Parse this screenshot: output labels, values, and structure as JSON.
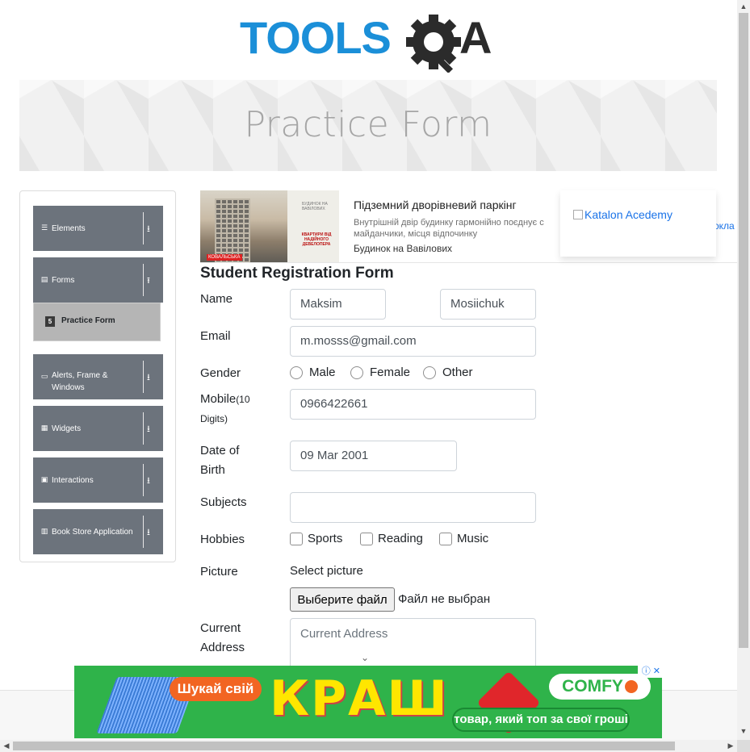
{
  "logo": {
    "text_left": "TOOLS",
    "text_right": "A",
    "colors": {
      "blue": "#1b8fd8",
      "dark": "#2b2b2b"
    }
  },
  "banner": {
    "title": "Practice Form"
  },
  "sidebar": {
    "groups": [
      {
        "label": "Elements",
        "icon": "hamburger-icon",
        "arrow": "⭳"
      },
      {
        "label": "Forms",
        "icon": "document-icon",
        "arrow": "⭱"
      },
      {
        "label": "Alerts, Frame & Windows",
        "icon": "window-icon",
        "arrow": "⭳"
      },
      {
        "label": "Widgets",
        "icon": "grid-icon",
        "arrow": "⭳"
      },
      {
        "label": "Interactions",
        "icon": "box-icon",
        "arrow": "⭳"
      },
      {
        "label": "Book Store Application",
        "icon": "books-icon",
        "arrow": "⭳"
      }
    ],
    "active_item": {
      "label": "Practice Form",
      "icon": "html5-icon",
      "icon_glyph": "5"
    }
  },
  "ad_top": {
    "title": "Підземний дворівневий паркінг",
    "description": "Внутрішній двір будинку гармонійно поєднує с майданчики, місця відпочинку",
    "brand": "Будинок на Вавілових",
    "more": "окла",
    "img_caption1": "БУДИНОК НА ВАВІЛОВИХ",
    "img_caption2": "КВАРТИРИ ВІД НАДІЙНОГО ДЕВЕЛОПЕРА",
    "img_tag": "КОВАЛЬСЬКА"
  },
  "katalon": {
    "alt": "Katalon Acedemy"
  },
  "form": {
    "title": "Student Registration Form",
    "labels": {
      "name": "Name",
      "email": "Email",
      "gender": "Gender",
      "mobile": "Mobile",
      "mobile_hint": "(10",
      "mobile_hint2": "Digits)",
      "dob1": "Date of",
      "dob2": "Birth",
      "subjects": "Subjects",
      "hobbies": "Hobbies",
      "picture": "Picture",
      "address1": "Current",
      "address2": "Address"
    },
    "values": {
      "first_name": "Maksim",
      "last_name": "Mosiichuk",
      "email": "m.mosss@gmail.com",
      "mobile": "0966422661",
      "dob": "09 Mar 2001",
      "subjects": ""
    },
    "gender_options": [
      "Male",
      "Female",
      "Other"
    ],
    "hobby_options": [
      "Sports",
      "Reading",
      "Music"
    ],
    "picture": {
      "select_label": "Select picture",
      "button": "Выберите файл",
      "status": "Файл не выбран"
    },
    "address_placeholder": "Current Address"
  },
  "ad_bottom": {
    "pill1": "Шукай свій",
    "headline": "КРАШ",
    "brand": "COMFY",
    "tagline": "товар, який топ за свої гроші",
    "close": "ⓘ ✕",
    "colors": {
      "green": "#2fb34a",
      "orange": "#f26522",
      "yellow": "#ffe600"
    }
  },
  "scrollbars": {
    "up": "▲",
    "down": "▼",
    "left": "◀",
    "right": "▶"
  }
}
